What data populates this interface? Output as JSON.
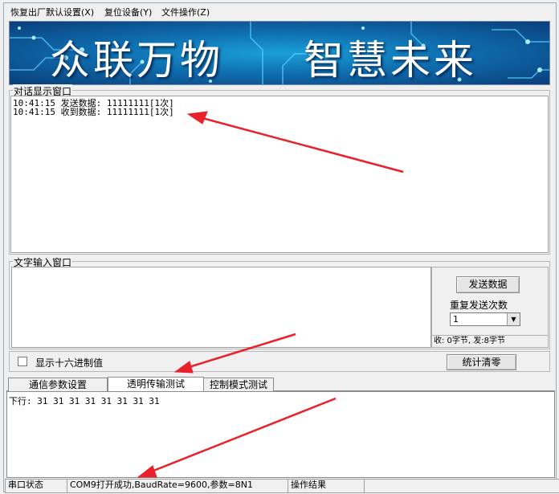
{
  "menu": {
    "items": [
      "恢复出厂默认设置(X)",
      "复位设备(Y)",
      "文件操作(Z)"
    ]
  },
  "banner": {
    "left_text": "众联万物",
    "right_text": "智慧未来"
  },
  "dialog": {
    "label": "对话显示窗口",
    "lines": [
      "10:41:15 发送数据: 11111111[1次]",
      "10:41:15 收到数据: 11111111[1次]"
    ]
  },
  "text_input": {
    "label": "文字输入窗口",
    "value": "",
    "send_button": "发送数据",
    "repeat_label": "重复发送次数",
    "repeat_value": "1",
    "counter": "收: 0字节, 发:8字节"
  },
  "options": {
    "hex_checkbox_label": "显示十六进制值",
    "hex_checked": false,
    "clear_stats_button": "统计清零"
  },
  "tabs": [
    "通信参数设置",
    "透明传输测试",
    "控制模式测试"
  ],
  "active_tab": 1,
  "downlink": {
    "text": "下行: 31 31 31 31 31 31 31 31"
  },
  "status_bar": {
    "port_label": "串口状态",
    "port_status": "COM9打开成功,BaudRate=9600,参数=8N1",
    "result_label": "操作结果",
    "result_value": ""
  },
  "colors": {
    "arrow": "#e8212b",
    "banner_dark": "#0a3d7a",
    "banner_light": "#1aa0d8"
  }
}
